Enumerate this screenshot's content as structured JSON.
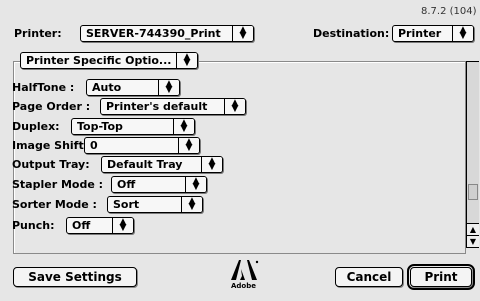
{
  "header": {
    "version": "8.7.2 (104)",
    "printer_label": "Printer:",
    "printer_value": "SERVER-744390_Print",
    "destination_label": "Destination:",
    "destination_value": "Printer"
  },
  "section": {
    "panel_value": "Printer Specific Optio..."
  },
  "options": [
    {
      "label": "HalfTone :",
      "value": "Auto"
    },
    {
      "label": "Page Order :",
      "value": "Printer's default"
    },
    {
      "label": "Duplex:",
      "value": "Top-Top"
    },
    {
      "label": "Image Shift :",
      "value": "0"
    },
    {
      "label": "Output Tray:",
      "value": "Default Tray"
    },
    {
      "label": "Stapler Mode :",
      "value": "Off"
    },
    {
      "label": "Sorter Mode :",
      "value": "Sort"
    },
    {
      "label": "Punch:",
      "value": "Off"
    }
  ],
  "footer": {
    "save_label": "Save Settings",
    "cancel_label": "Cancel",
    "print_label": "Print",
    "logo_text": "Adobe"
  }
}
